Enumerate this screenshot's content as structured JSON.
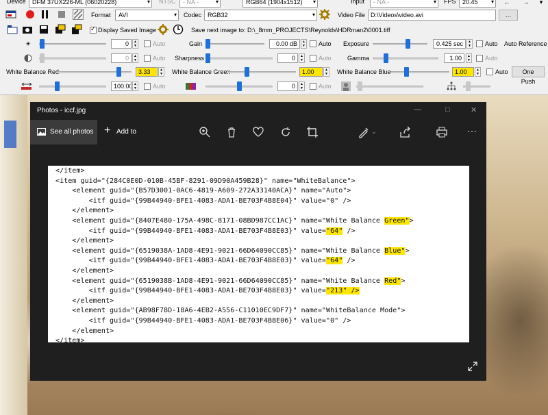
{
  "toolbar": {
    "row1": {
      "device_label": "Device",
      "device_value": "DFM 37UX226-ML (06020228)",
      "ntsc_label": "NTSC",
      "ntsc_value": "- NA -",
      "pixel_format_value": "RGB64 (1904x1512)",
      "input_label": "Input",
      "input_value": "- NA -",
      "fps_label": "FPS",
      "fps_value": "20.45"
    },
    "row2": {
      "format_label": "Format",
      "format_value": "AVI",
      "codec_label": "Codec",
      "codec_value": "RGB32",
      "video_file_label": "Video File",
      "video_file_value": "D:\\Videos\\video.avi"
    },
    "row3": {
      "display_saved_label": "Display Saved Image",
      "save_next_text": "Save next image to: D:\\_8mm_PROJECTS\\Reynolds\\HDRman2\\0001.tiff"
    },
    "row4": {
      "brightness_value": "0",
      "auto_label": "Auto",
      "gain_label": "Gain",
      "gain_value": "0.00 dB",
      "exposure_label": "Exposure",
      "exposure_value": "0.425 sec",
      "auto_reference_label": "Auto Reference"
    },
    "row5": {
      "contrast_value": "0",
      "sharpness_label": "Sharpness",
      "sharpness_value": "0",
      "gamma_label": "Gamma",
      "gamma_value": "1.00"
    },
    "row6": {
      "wb_red_label": "White Balance Red",
      "wb_red_value": "3.33",
      "wb_green_label": "White Balance Green",
      "wb_green_value": "1.00",
      "wb_blue_label": "White Balance Blue",
      "wb_blue_value": "1.00",
      "one_push_label": "One Push"
    },
    "row7": {
      "value_a": "100.00",
      "value_b": "0"
    }
  },
  "photos": {
    "title": "Photos - iccf.jpg",
    "see_all_label": "See all photos",
    "add_to_label": "Add to"
  },
  "document_lines": [
    "</item>",
    "<item guid=\"{284C0E0D-010B-45BF-8291-09D90A459B28}\" name=\"WhiteBalance\">",
    "    <element guid=\"{B57D3001-0AC6-4819-A609-272A33140ACA}\" name=\"Auto\">",
    "        <itf guid=\"{99B44940-BFE1-4083-ADA1-BE703F4B8E04}\" value=\"0\" />",
    "    </element>",
    "    <element guid=\"{8407E480-175A-498C-8171-08BD987CC1AC}\" name=\"White Balance Green\">",
    "        <itf guid=\"{99B44940-BFE1-4083-ADA1-BE703F4B8E03}\" value=\"64\" />",
    "    </element>",
    "    <element guid=\"{6519038A-1AD8-4E91-9021-66D64090CC85}\" name=\"White Balance Blue\">",
    "        <itf guid=\"{99B44940-BFE1-4083-ADA1-BE703F4B8E03}\" value=\"64\" />",
    "    </element>",
    "    <element guid=\"{6519038B-1AD8-4E91-9021-66D64090CC85}\" name=\"White Balance Red\">",
    "        <itf guid=\"{99B44940-BFE1-4083-ADA1-BE703F4B8E03}\" value=\"213\" />",
    "    </element>",
    "    <element guid=\"{AB98F78D-18A6-4EB2-A556-C11010EC9DF7}\" name=\"WhiteBalance Mode\">",
    "        <itf guid=\"{99B44940-BFE1-4083-ADA1-BE703F4B8E06}\" value=\"0\" />",
    "    </element>",
    "</item>"
  ],
  "highlights": [
    "Green\"",
    "\"64\"",
    "Blue\"",
    "\"64\"",
    "Red\"",
    "\"213\" />"
  ],
  "colors": {
    "highlight": "#ffe600",
    "slider_thumb": "#1e6fd9",
    "photos_bg": "#1f1f1f"
  }
}
